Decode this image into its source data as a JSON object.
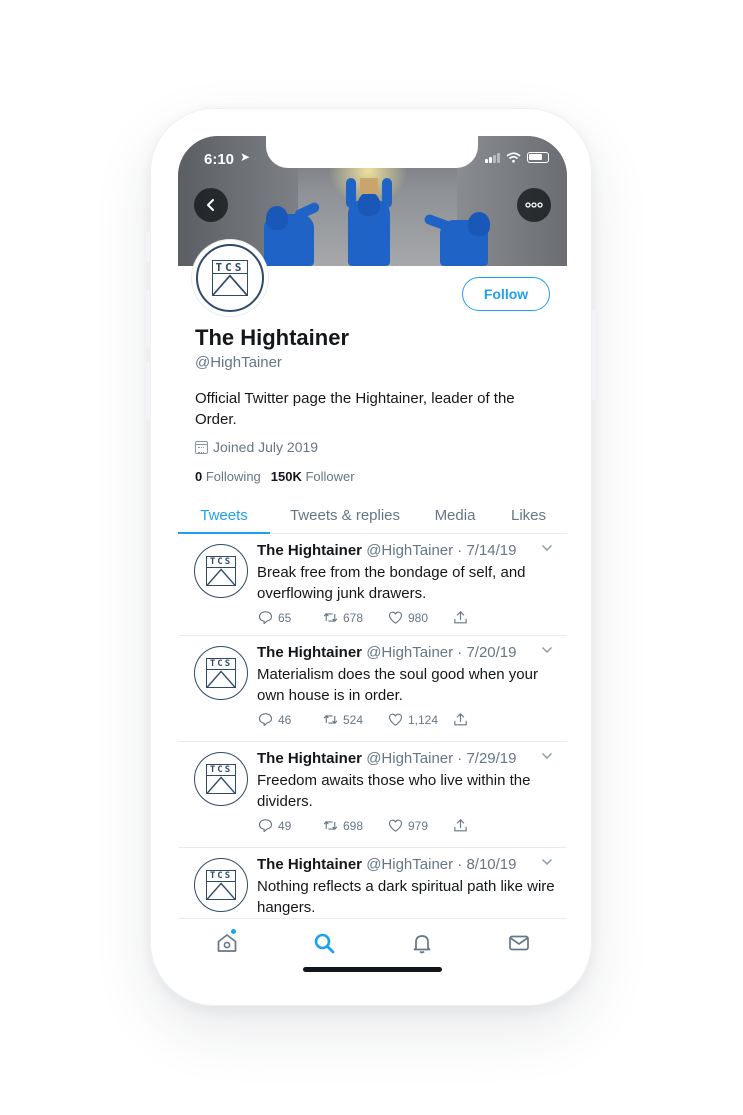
{
  "status_bar": {
    "time": "6:10"
  },
  "profile": {
    "name": "The Hightainer",
    "handle": "@HighTainer",
    "bio": "Official Twitter page the Hightainer, leader of the Order.",
    "joined": "Joined July 2019",
    "following_count": "0",
    "following_label": "Following",
    "followers_count": "150K",
    "followers_label": "Follower",
    "follow_button": "Follow",
    "avatar_text": "TCS"
  },
  "tabs": [
    {
      "label": "Tweets",
      "active": true
    },
    {
      "label": "Tweets & replies",
      "active": false
    },
    {
      "label": "Media",
      "active": false
    },
    {
      "label": "Likes",
      "active": false
    }
  ],
  "tweets": [
    {
      "name": "The Hightainer",
      "meta": "@HighTainer · 7/14/19",
      "text": "Break free from the bondage of self, and overflowing junk drawers.",
      "replies": "65",
      "retweets": "678",
      "likes": "980"
    },
    {
      "name": "The Hightainer",
      "meta": "@HighTainer · 7/20/19",
      "text": "Materialism does the soul good when your own house is in order.",
      "replies": "46",
      "retweets": "524",
      "likes": "1,124"
    },
    {
      "name": "The Hightainer",
      "meta": "@HighTainer · 7/29/19",
      "text": "Freedom awaits those who live within the dividers.",
      "replies": "49",
      "retweets": "698",
      "likes": "979"
    },
    {
      "name": "The Hightainer",
      "meta": "@HighTainer · 8/10/19",
      "text": "Nothing reflects a dark spiritual path like wire hangers.",
      "replies": "",
      "retweets": "",
      "likes": ""
    }
  ],
  "colors": {
    "accent": "#1da1f2",
    "text": "#14171a",
    "secondary": "#657786",
    "divider": "#e6ecf0",
    "logo": "#2f4a6b"
  },
  "icons": [
    "back-arrow-icon",
    "more-icon",
    "calendar-icon",
    "reply-icon",
    "retweet-icon",
    "like-icon",
    "share-icon",
    "home-icon",
    "search-icon",
    "bell-icon",
    "mail-icon"
  ]
}
